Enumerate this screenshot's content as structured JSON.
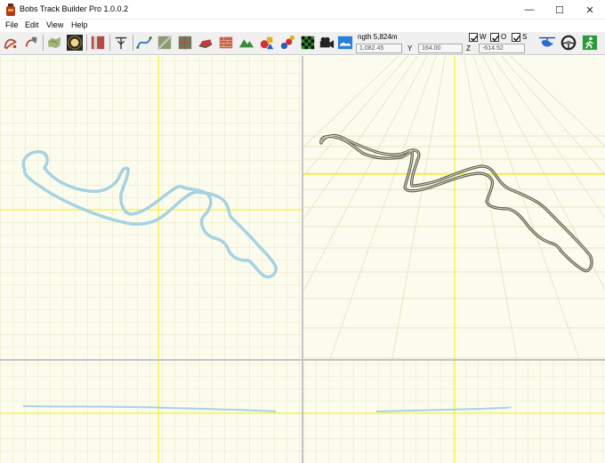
{
  "window": {
    "title": "Bobs Track Builder Pro 1.0.0.2",
    "minimize_glyph": "—",
    "maximize_glyph": "☐",
    "close_glyph": "✕"
  },
  "menu": [
    "File",
    "Edit",
    "View",
    "Help"
  ],
  "toolbar": {
    "icons": [
      "track-curve-icon",
      "track-edit-icon",
      "terrain-map-icon",
      "sun-light-icon",
      "wall-texture-icon",
      "track-split-icon",
      "spline-curve-icon",
      "road-grid-icon",
      "surface-grid-icon",
      "car-object-icon",
      "brick-wall-icon",
      "mountain-icon",
      "shapes-icon",
      "objects-icon",
      "checkered-flag-icon",
      "camera-icon",
      "sky-icon"
    ],
    "right_icons": [
      "helicopter-icon",
      "steering-wheel-icon",
      "exit-icon"
    ]
  },
  "readout": {
    "length": "ngth 5,824m",
    "x_value": "1,082.45",
    "y_label": "Y",
    "y_value": "164.00",
    "z_label": "Z",
    "z_value": "-614.52"
  },
  "toggles": [
    {
      "label": "W",
      "checked": true
    },
    {
      "label": "O",
      "checked": true
    },
    {
      "label": "S",
      "checked": true
    }
  ],
  "colors": {
    "grid": "#e6e6c4",
    "axis": "#f3f000",
    "track_top": "#a6d2e2",
    "track_3d": "#5b5b4a",
    "viewport_bg": "#fcfcee",
    "divider": "#c4c4c4"
  }
}
